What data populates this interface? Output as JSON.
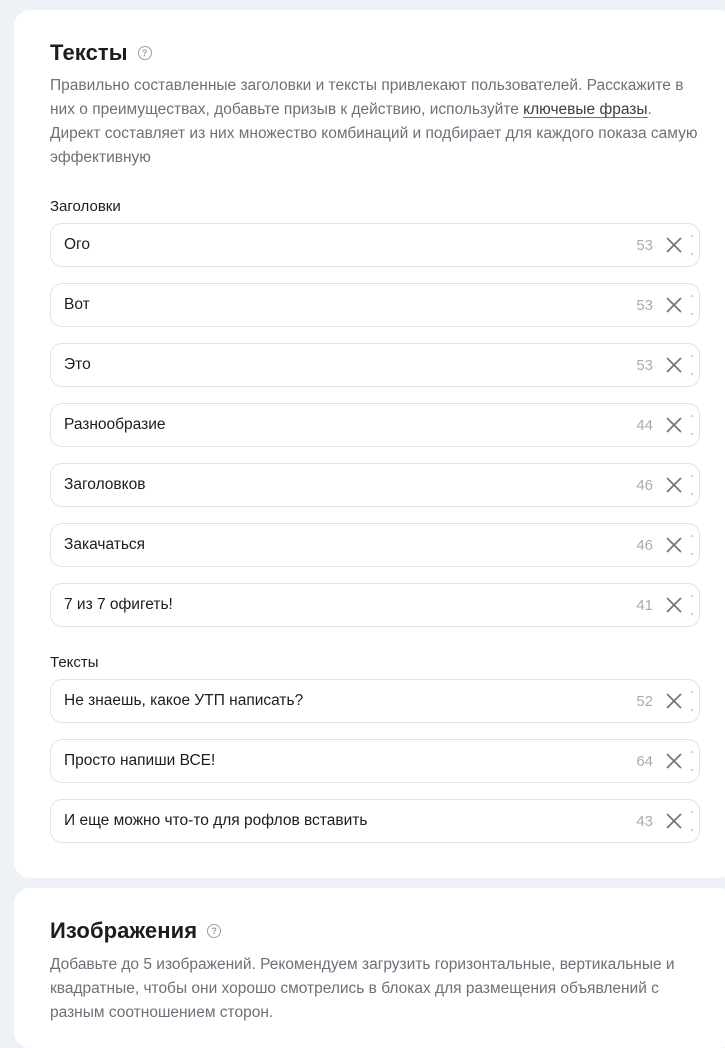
{
  "texts_section": {
    "title": "Тексты",
    "help_icon": "question-circle-icon",
    "description_part1": "Правильно составленные заголовки и тексты привлекают пользователей. Расскажите в них о преимуществах, добавьте призыв к действию, используйте ",
    "description_link": "ключевые фразы",
    "description_part2": ". Директ составляет из них множество комбинаций и подбирает для каждого показа самую эффективную",
    "headlines_label": "Заголовки",
    "headlines": [
      {
        "value": "Ого",
        "counter": "53"
      },
      {
        "value": "Вот",
        "counter": "53"
      },
      {
        "value": "Это",
        "counter": "53"
      },
      {
        "value": "Разнообразие",
        "counter": "44"
      },
      {
        "value": "Заголовков",
        "counter": "46"
      },
      {
        "value": "Закачаться",
        "counter": "46"
      },
      {
        "value": "7 из 7 офигеть!",
        "counter": "41"
      }
    ],
    "texts_label": "Тексты",
    "texts": [
      {
        "value": "Не знаешь, какое УТП написать?",
        "counter": "52"
      },
      {
        "value": "Просто напиши ВСЕ!",
        "counter": "64"
      },
      {
        "value": "И еще можно что-то для рофлов вставить",
        "counter": "43"
      }
    ]
  },
  "images_section": {
    "title": "Изображения",
    "help_icon": "question-circle-icon",
    "description": "Добавьте до 5 изображений. Рекомендуем загрузить горизонтальные, вертикальные и квадратные, чтобы они хорошо смотрелись в блоках для размещения объявлений с разным соотношением сторон."
  },
  "colors": {
    "page_bg": "#eef1f5",
    "card_bg": "#ffffff",
    "muted_text": "#6c7078",
    "counter_text": "#a7acb3",
    "field_border": "#dfe2e7"
  }
}
